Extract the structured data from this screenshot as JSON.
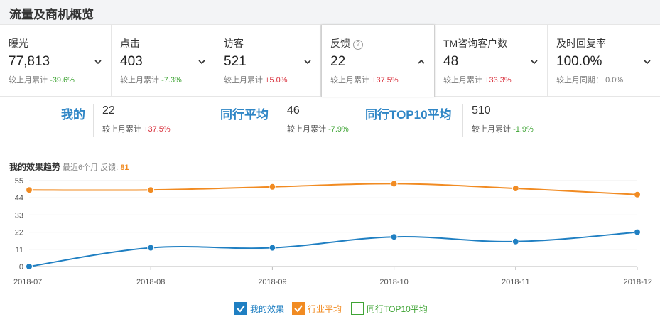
{
  "header": {
    "title": "流量及商机概览"
  },
  "metrics": [
    {
      "label": "曝光",
      "value": "77,813",
      "compare_label": "较上月累计",
      "compare_value": "-39.6%",
      "trend": "down"
    },
    {
      "label": "点击",
      "value": "403",
      "compare_label": "较上月累计",
      "compare_value": "-7.3%",
      "trend": "down"
    },
    {
      "label": "访客",
      "value": "521",
      "compare_label": "较上月累计",
      "compare_value": "+5.0%",
      "trend": "up"
    },
    {
      "label": "反馈",
      "help_glyph": "?",
      "value": "22",
      "compare_label": "较上月累计",
      "compare_value": "+37.5%",
      "trend": "up",
      "active": true
    },
    {
      "label": "TM咨询客户数",
      "value": "48",
      "compare_label": "较上月累计",
      "compare_value": "+33.3%",
      "trend": "up"
    },
    {
      "label": "及时回复率",
      "value": "100.0%",
      "compare_label": "较上月同期：",
      "compare_value": "0.0%",
      "trend": "flat"
    }
  ],
  "comparison": {
    "mine": {
      "label": "我的",
      "value": "22",
      "compare_label": "较上月累计",
      "compare_value": "+37.5%",
      "trend": "up"
    },
    "industry": {
      "label": "同行平均",
      "value": "46",
      "compare_label": "较上月累计",
      "compare_value": "-7.9%",
      "trend": "down"
    },
    "top10": {
      "label": "同行TOP10平均",
      "value": "510",
      "compare_label": "较上月累计",
      "compare_value": "-1.9%",
      "trend": "down"
    }
  },
  "trend": {
    "title": "我的效果趋势",
    "subtitle_prefix": "最近6个月 反馈:",
    "count": "81"
  },
  "chart_data": {
    "type": "line",
    "x": [
      "2018-07",
      "2018-08",
      "2018-09",
      "2018-10",
      "2018-11",
      "2018-12"
    ],
    "yticks": [
      0,
      11,
      22,
      33,
      44,
      55
    ],
    "ylim": [
      0,
      55
    ],
    "grid": true,
    "series": [
      {
        "name": "我的效果",
        "color": "#1f7fc2",
        "values": [
          0,
          12,
          12,
          19,
          16,
          22
        ]
      },
      {
        "name": "行业平均",
        "color": "#f18b22",
        "values": [
          49,
          49,
          51,
          53,
          50,
          46
        ]
      }
    ]
  },
  "legend": [
    {
      "label": "我的效果",
      "color": "#1f7fc2",
      "checked": true
    },
    {
      "label": "行业平均",
      "color": "#f18b22",
      "checked": true
    },
    {
      "label": "同行TOP10平均",
      "color": "#3fa435",
      "checked": false
    }
  ]
}
